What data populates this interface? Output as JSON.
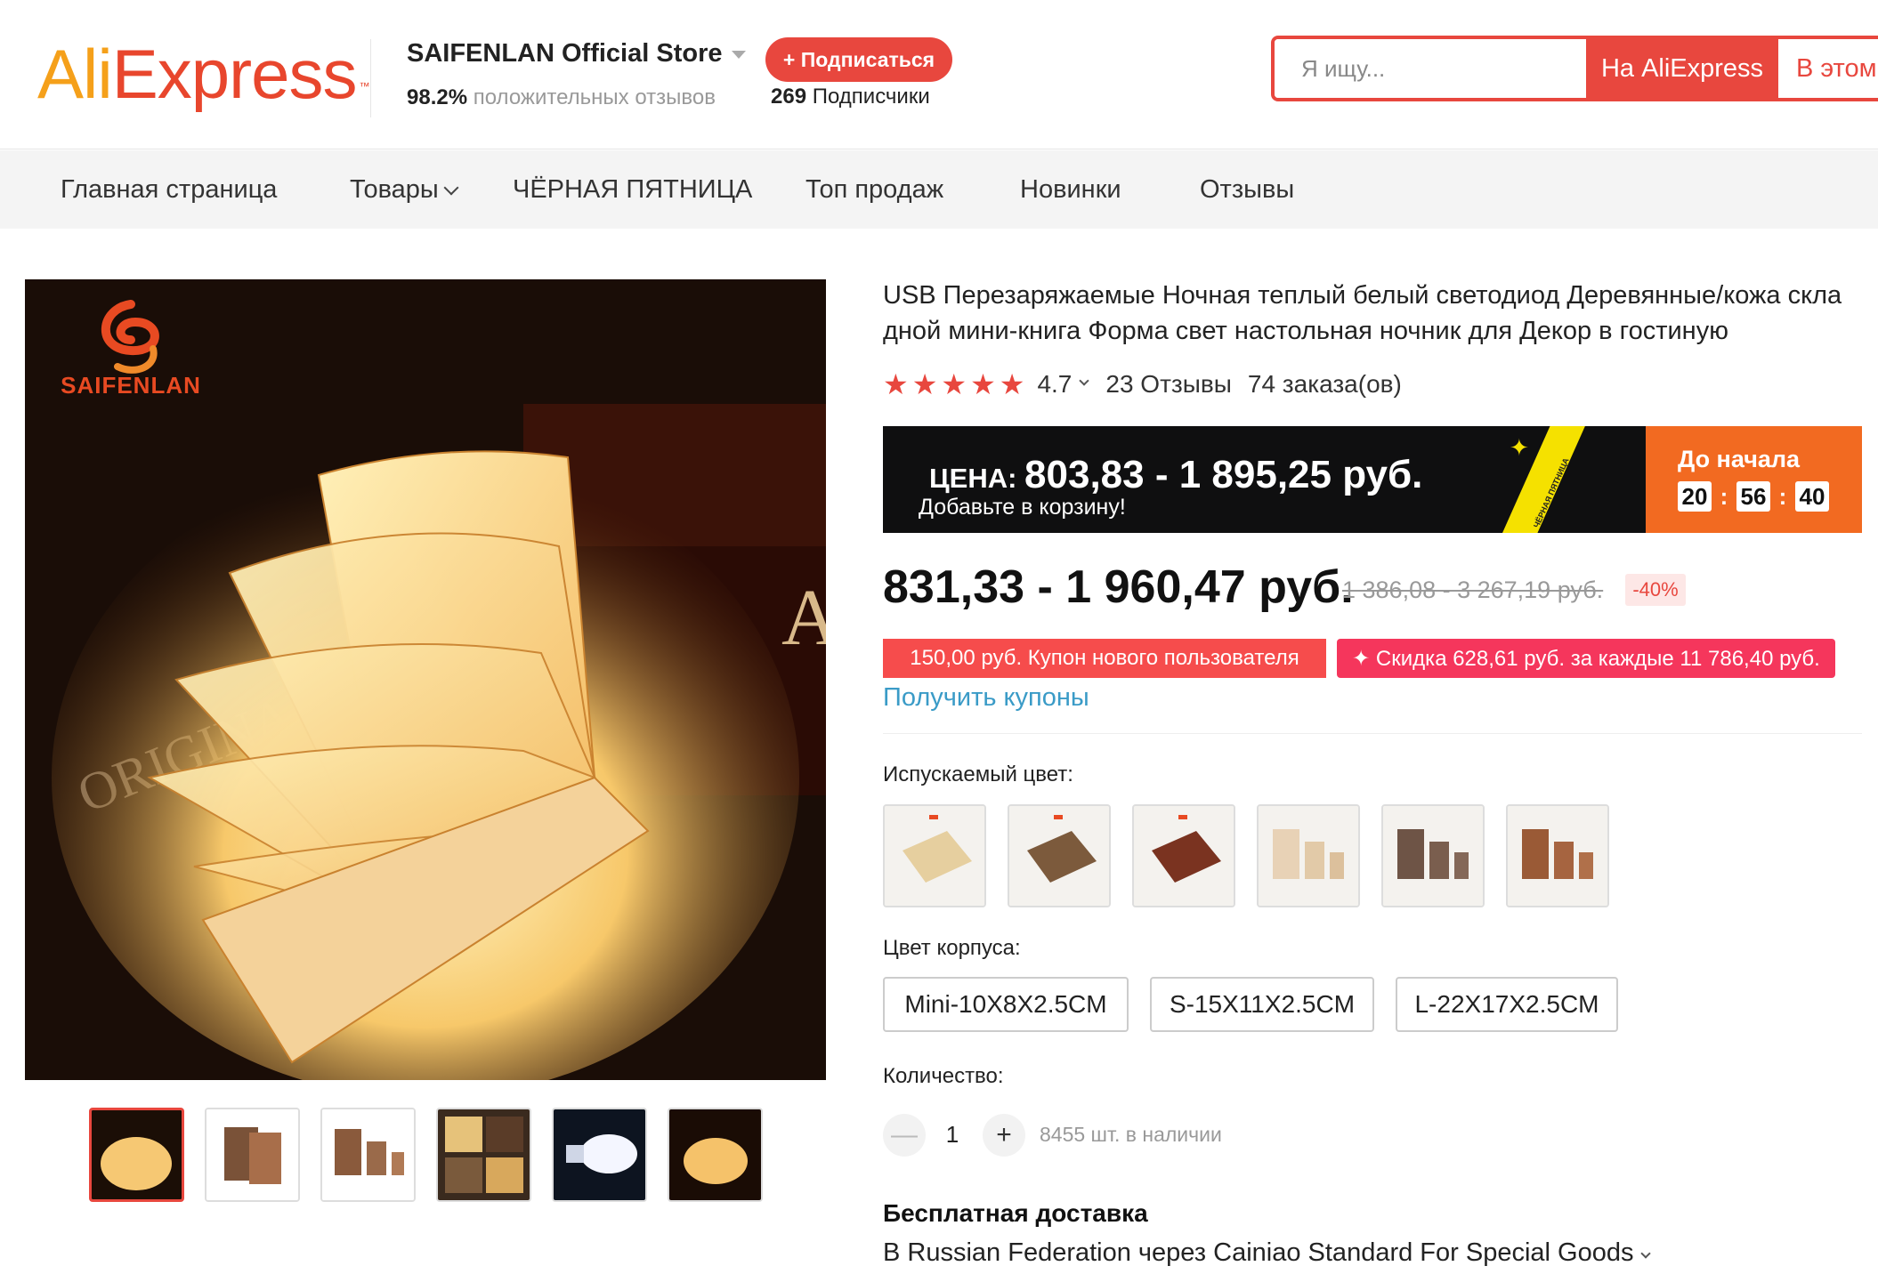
{
  "header": {
    "logo": {
      "ali": "Ali",
      "express": "Express",
      "tm": "™"
    },
    "store": {
      "name": "SAIFENLAN Official Store",
      "rating_value": "98.2%",
      "rating_label": "положительных отзывов",
      "subscribe_label": "+ Подписаться",
      "followers_count": "269",
      "followers_label": "Подписчики"
    },
    "search": {
      "placeholder": "Я ищу...",
      "btn_aliexpress": "На AliExpress",
      "btn_store": "В этом"
    }
  },
  "nav": {
    "items": [
      "Главная страница",
      "Товары",
      "ЧЁРНАЯ ПЯТНИЦА",
      "Топ продаж",
      "Новинки",
      "Отзывы"
    ]
  },
  "gallery": {
    "brand": "SAIFENLAN",
    "selected_thumb": 1,
    "thumbs": [
      "thumb-1",
      "thumb-2",
      "thumb-3",
      "thumb-4",
      "thumb-5",
      "thumb-6"
    ]
  },
  "product": {
    "title": "USB Перезаряжаемые Ночная теплый белый светодиод Деревянные/кожа скла дной мини-книга Форма свет настольная ночник для Декор в гостиную",
    "rating": "4.7",
    "stars": 5,
    "reviews": "23 Отзывы",
    "orders": "74 заказа(ов)",
    "promo": {
      "price_label": "ЦЕНА:",
      "price_value": "803,83 - 1 895,25 руб.",
      "cart_hint": "Добавьте в корзину!",
      "sash_text": "ЧЁРНАЯ ПЯТНИЦА",
      "countdown_label": "До начала",
      "countdown": {
        "h": "20",
        "m": "56",
        "s": "40"
      }
    },
    "price": "831,33 - 1 960,47 руб.",
    "old_price": "1 386,08 - 3 267,19 руб.",
    "discount": "-40%",
    "coupon_new_user": "150,00 руб. Купон нового пользователя",
    "coupon_discount": "✦ Скидка 628,61 руб. за каждые 11 786,40 руб.",
    "get_coupons": "Получить купоны",
    "color_label": "Испускаемый цвет:",
    "body_label": "Цвет корпуса:",
    "sizes": [
      "Mini-10X8X2.5CM",
      "S-15X11X2.5CM",
      "L-22X17X2.5CM"
    ],
    "qty_label": "Количество:",
    "qty": {
      "minus": "—",
      "value": "1",
      "plus": "+",
      "stock": "8455 шт. в наличии"
    },
    "shipping_title": "Бесплатная доставка",
    "shipping_line": "В Russian Federation через Cainiao Standard For Special Goods"
  },
  "colors": {
    "accent": "#e8473e",
    "promo_orange": "#f26a21",
    "link": "#3a9bc7",
    "coupon_pink": "#f5365c"
  }
}
